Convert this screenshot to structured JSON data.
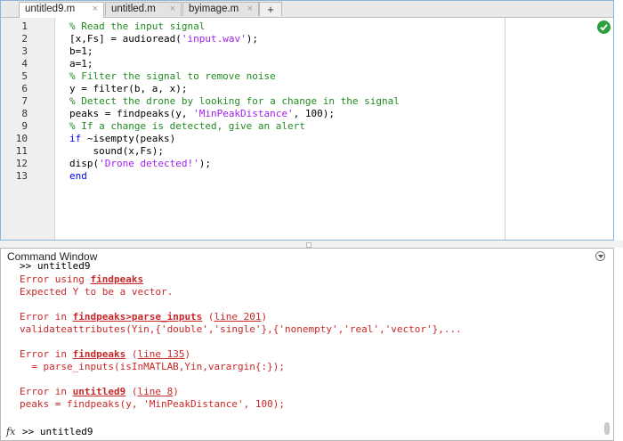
{
  "editor": {
    "tabs": [
      {
        "label": "untitled9.m",
        "close": "×",
        "active": true
      },
      {
        "label": "untitled.m",
        "close": "×",
        "active": false
      },
      {
        "label": "byimage.m",
        "close": "×",
        "active": false
      }
    ],
    "new_tab": "+",
    "line_numbers": [
      "1",
      "2",
      "3",
      "4",
      "5",
      "6",
      "7",
      "8",
      "9",
      "10",
      "11",
      "12",
      "13"
    ],
    "code": {
      "l1": "% Read the input signal",
      "l2a": "[x,Fs] = audioread(",
      "l2s": "'input.wav'",
      "l2b": ");",
      "l3": "b=1;",
      "l4": "a=1;",
      "l5": "% Filter the signal to remove noise",
      "l6": "y = filter(b, a, x);",
      "l7": "% Detect the drone by looking for a change in the signal",
      "l8a": "peaks = findpeaks(y, ",
      "l8s": "'MinPeakDistance'",
      "l8b": ", 100);",
      "l9": "% If a change is detected, give an alert",
      "l10k": "if",
      "l10b": " ~isempty(peaks)",
      "l11": "    sound(x,Fs);",
      "l12a": "disp(",
      "l12s": "'Drone detected!'",
      "l12b": ");",
      "l13": "end"
    },
    "status_icon": "checkmark-icon"
  },
  "command_window": {
    "title": "Command Window",
    "menu_icon": "chevron-down-icon",
    "output": {
      "o1": ">> untitled9",
      "e1a": "Error using ",
      "e1link": "findpeaks",
      "e2": "Expected Y to be a vector.",
      "e3a": "Error in ",
      "e3link": "findpeaks>parse_inputs",
      "e3b": " (",
      "e3line": "line 201",
      "e3c": ")",
      "e4": "validateattributes(Yin,{'double','single'},{'nonempty','real','vector'},...",
      "e5a": "Error in ",
      "e5link": "findpeaks",
      "e5b": " (",
      "e5line": "line 135",
      "e5c": ")",
      "e6": "  = parse_inputs(isInMATLAB,Yin,varargin{:});",
      "e7a": "Error in ",
      "e7link": "untitled9",
      "e7b": " (",
      "e7line": "line 8",
      "e7c": ")",
      "e8": "peaks = findpeaks(y, 'MinPeakDistance', 100);"
    },
    "prompt_fx": "fx",
    "prompt": ">> untitled9"
  },
  "colors": {
    "comment": "#228b22",
    "keyword": "#0000ff",
    "string": "#a020f0",
    "error": "#c82828"
  }
}
